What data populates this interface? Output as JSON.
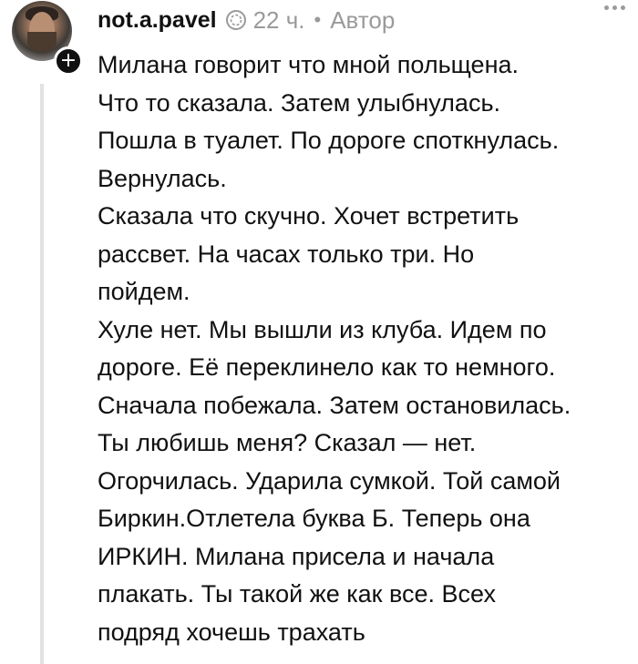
{
  "comment": {
    "author": "not.a.pavel",
    "time": "22 ч.",
    "badge": "Автор",
    "lines": [
      "Милана говорит что мной польщена.",
      "Что то сказала. Затем улыбнулась.",
      "Пошла в туалет. По дороге споткнулась.",
      "Вернулась.",
      "Сказала что скучно. Хочет встретить",
      "рассвет. На часах только три. Но",
      "пойдем.",
      "Хуле нет. Мы вышли из клуба. Идем по",
      "дороге. Её переклинело как то немного.",
      "Сначала побежала. Затем остановилась.",
      "Ты любишь меня? Сказал — нет.",
      "Огорчилась. Ударила сумкой. Той самой",
      "Биркин.Отлетела буква Б. Теперь она",
      "ИРКИН. Милана присела и начала",
      "плакать. Ты такой же как все. Всех",
      "подряд хочешь трахать"
    ]
  },
  "icons": {
    "avatar": "avatar-photo",
    "follow": "plus-icon",
    "edited": "ring-icon",
    "more": "more-dots-icon"
  },
  "colors": {
    "text": "#111111",
    "meta": "#9a9a9a",
    "thread_line": "#e2e2e2"
  }
}
